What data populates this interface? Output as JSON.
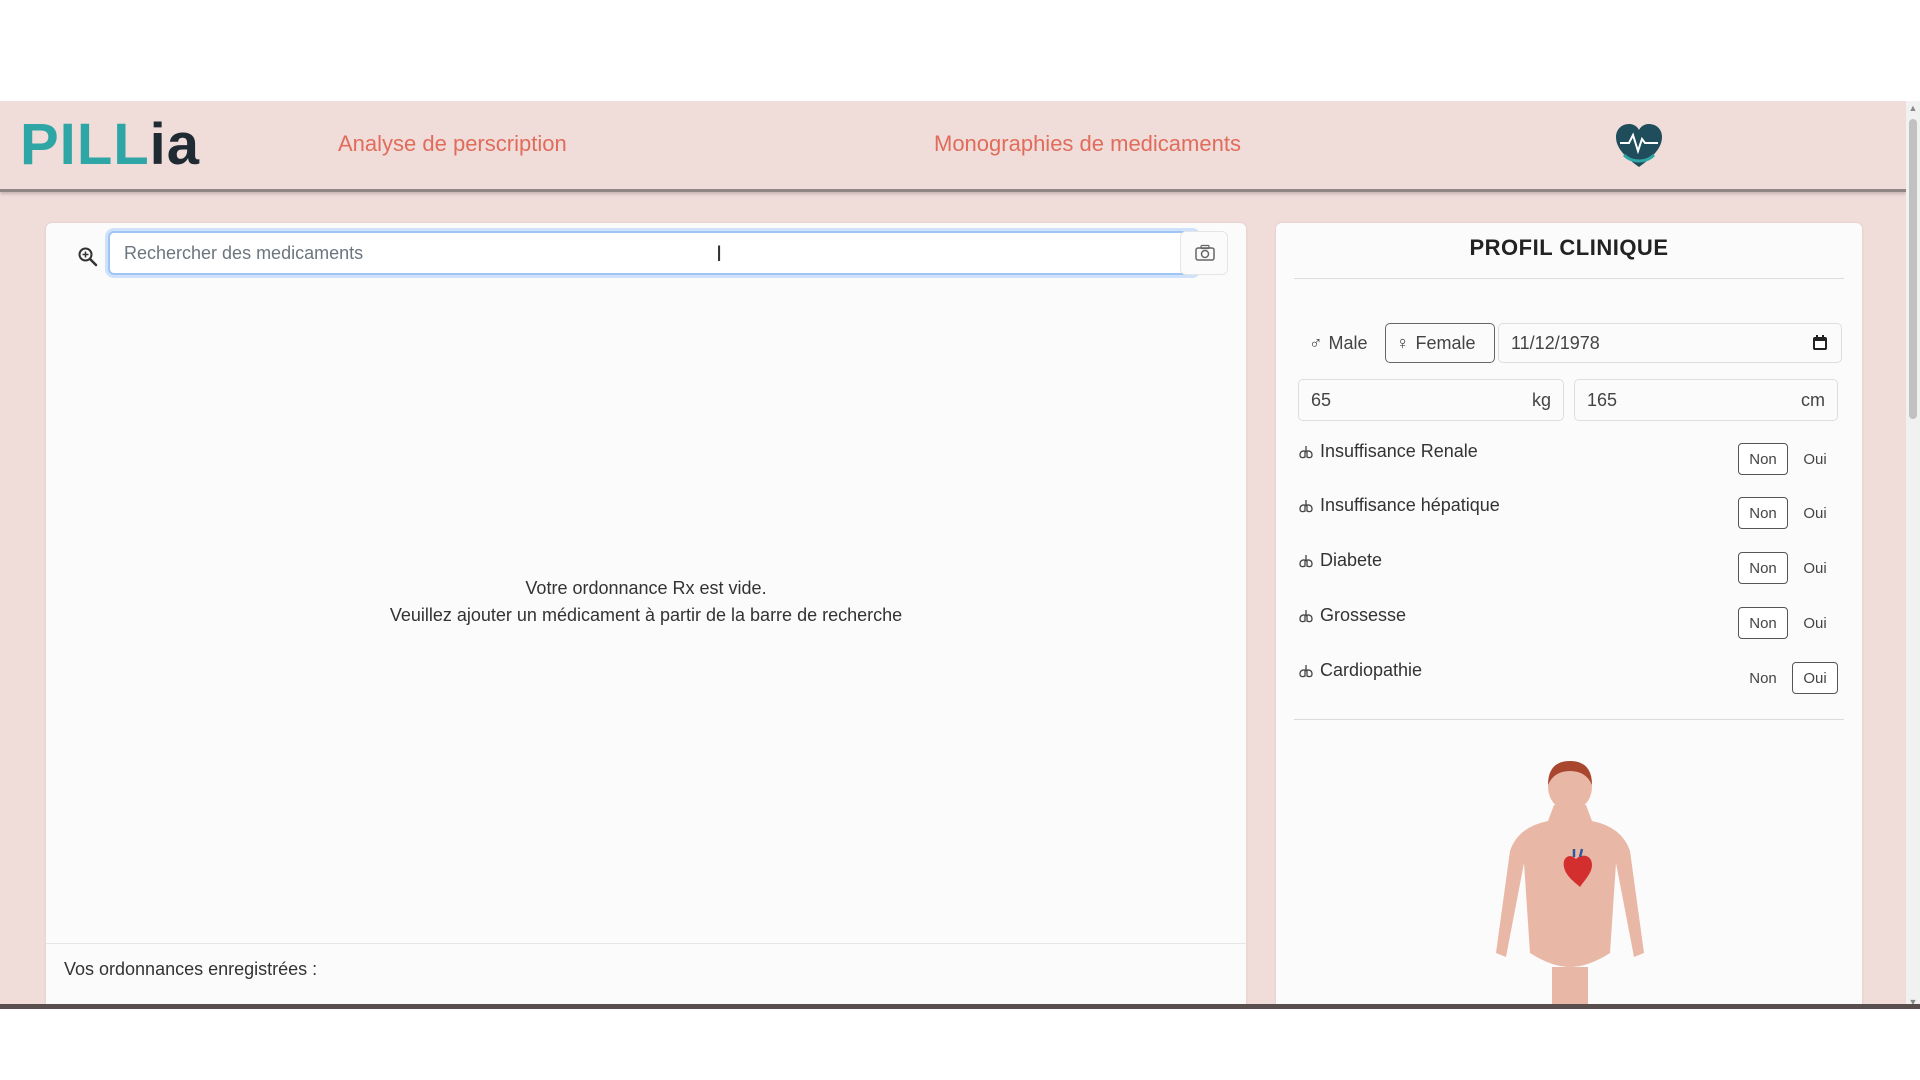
{
  "navbar": {
    "logo": {
      "part1": "PI",
      "part2": "LL",
      "part3": "ia"
    },
    "links": [
      "Analyse de perscription",
      "Monographies de medicaments"
    ]
  },
  "search": {
    "placeholder": "Rechercher des medicaments",
    "value": ""
  },
  "prescription": {
    "empty_line1": "Votre ordonnance Rx est vide.",
    "empty_line2": "Veuillez ajouter un médicament à partir de la barre de recherche",
    "saved_label": "Vos ordonnances enregistrées :"
  },
  "profile": {
    "title": "PROFIL CLINIQUE",
    "sex": {
      "male": "Male",
      "female": "Female",
      "selected": "Female"
    },
    "birthdate": "11/12/1978",
    "weight": {
      "value": "65",
      "unit": "kg"
    },
    "height": {
      "value": "165",
      "unit": "cm"
    },
    "conditions": [
      {
        "label": "Insuffisance Renale",
        "no": "Non",
        "yes": "Oui",
        "selected": "Non"
      },
      {
        "label": "Insuffisance hépatique",
        "no": "Non",
        "yes": "Oui",
        "selected": "Non"
      },
      {
        "label": "Diabete",
        "no": "Non",
        "yes": "Oui",
        "selected": "Non"
      },
      {
        "label": "Grossesse",
        "no": "Non",
        "yes": "Oui",
        "selected": "Non"
      },
      {
        "label": "Cardiopathie",
        "no": "Non",
        "yes": "Oui",
        "selected": "Oui"
      }
    ]
  },
  "colors": {
    "background": "#f0dcd9",
    "nav_link": "#e06c5c",
    "logo_teal": "#2fa6a6",
    "logo_dark": "#1f2a33"
  },
  "icons": [
    "search-icon",
    "camera-icon",
    "male-icon",
    "female-icon",
    "calendar-icon",
    "lungs-icon",
    "heart-logo-icon"
  ]
}
